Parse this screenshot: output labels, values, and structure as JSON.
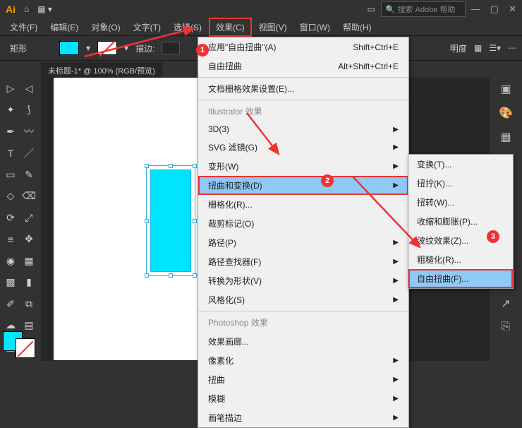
{
  "title": {
    "search_placeholder": "搜索 Adobe 帮助"
  },
  "menu": {
    "file": "文件(F)",
    "edit": "编辑(E)",
    "object": "对象(O)",
    "type": "文字(T)",
    "select": "选择(S)",
    "effect": "效果(C)",
    "view": "视图(V)",
    "window": "窗口(W)",
    "help": "帮助(H)"
  },
  "toolbar": {
    "shape": "矩形",
    "stroke_label": "描边:",
    "opacity_label": "明度"
  },
  "doc": {
    "tab": "未标题-1* @ 100% (RGB/预览)"
  },
  "menu1": {
    "apply": "应用\"自由扭曲\"(A)",
    "apply_sc": "Shift+Ctrl+E",
    "last": "自由扭曲",
    "last_sc": "Alt+Shift+Ctrl+E",
    "docraster": "文档栅格效果设置(E)...",
    "hdr1": "Illustrator 效果",
    "i3d": "3D(3)",
    "svg": "SVG 滤镜(G)",
    "warp": "变形(W)",
    "distort": "扭曲和变换(D)",
    "raster": "栅格化(R)...",
    "crop": "裁剪标记(O)",
    "path": "路径(P)",
    "pathfinder": "路径查找器(F)",
    "convert": "转换为形状(V)",
    "stylize": "风格化(S)",
    "hdr2": "Photoshop 效果",
    "gallery": "效果画廊...",
    "pixel": "像素化",
    "distort2": "扭曲",
    "blur": "模糊",
    "brush": "画笔描边"
  },
  "menu2": {
    "transform": "变换(T)...",
    "twist": "扭拧(K)...",
    "spin": "扭转(W)...",
    "pucker": "收缩和膨胀(P)...",
    "ripple": "波纹效果(Z)...",
    "rough": "粗糙化(R)...",
    "free": "自由扭曲(F)..."
  },
  "badges": {
    "b1": "1",
    "b2": "2",
    "b3": "3"
  }
}
